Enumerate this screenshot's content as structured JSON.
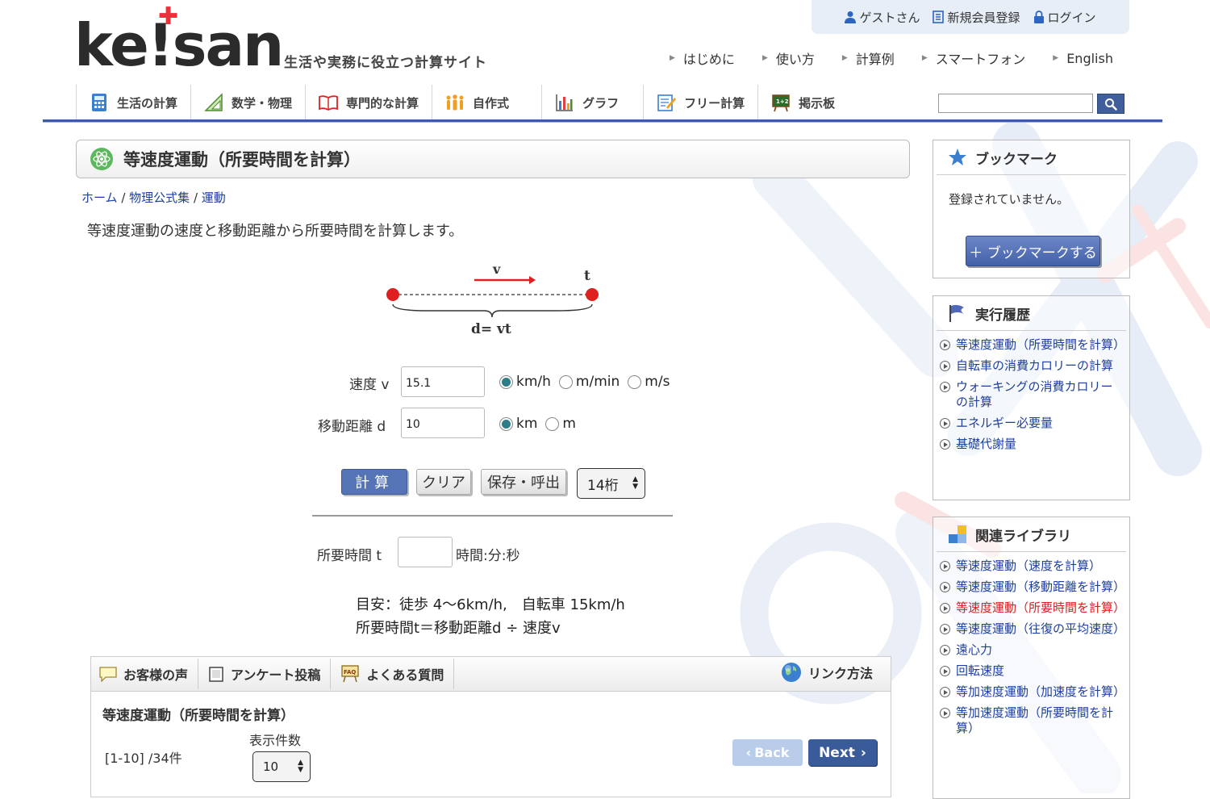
{
  "header": {
    "logo_text": "ke!san",
    "tagline": "生活や実務に役立つ計算サイト",
    "user_bar": {
      "guest": "ゲストさん",
      "register": "新規会員登録",
      "login": "ログイン"
    },
    "top_nav": [
      "はじめに",
      "使い方",
      "計算例",
      "スマートフォン",
      "English"
    ]
  },
  "main_menu": [
    {
      "label": "生活の計算",
      "icon": "calculator-icon"
    },
    {
      "label": "数学・物理",
      "icon": "triangle-ruler-icon"
    },
    {
      "label": "専門的な計算",
      "icon": "book-icon"
    },
    {
      "label": "自作式",
      "icon": "people-icon"
    },
    {
      "label": "グラフ",
      "icon": "bar-chart-icon"
    },
    {
      "label": "フリー計算",
      "icon": "memo-pencil-icon"
    },
    {
      "label": "掲示板",
      "icon": "blackboard-icon"
    }
  ],
  "search": {
    "placeholder": ""
  },
  "page": {
    "title": "等速度運動（所要時間を計算）",
    "breadcrumb": [
      "ホーム",
      "物理公式集",
      "運動"
    ],
    "description": "等速度運動の速度と移動距離から所要時間を計算します。"
  },
  "diagram": {
    "v_label": "v",
    "t_label": "t",
    "formula": "d= vt"
  },
  "form": {
    "speed_label": "速度 v",
    "speed_value": "15.1",
    "speed_units": [
      {
        "label": "km/h",
        "selected": true
      },
      {
        "label": "m/min",
        "selected": false
      },
      {
        "label": "m/s",
        "selected": false
      }
    ],
    "distance_label": "移動距離 d",
    "distance_value": "10",
    "distance_units": [
      {
        "label": "km",
        "selected": true
      },
      {
        "label": "m",
        "selected": false
      }
    ],
    "calc_button": "計算",
    "clear_button": "クリア",
    "save_button": "保存・呼出",
    "digits": "14桁",
    "result_label": "所要時間 t",
    "result_value": "",
    "result_unit": "時間:分:秒"
  },
  "notes": [
    "目安：徒歩 4〜6km/h,　自転車 15km/h",
    "所要時間t＝移動距離d ÷ 速度v"
  ],
  "bottom": {
    "tabs": [
      "お客様の声",
      "アンケート投稿",
      "よくある質問"
    ],
    "link_method": "リンク方法",
    "title": "等速度運動（所要時間を計算）",
    "range": "[1-10] /34件",
    "per_page_label": "表示件数",
    "per_page": "10",
    "back": "Back",
    "next": "Next"
  },
  "sidebar": {
    "bookmark": {
      "title": "ブックマーク",
      "empty": "登録されていません。",
      "button": "＋ ブックマークする"
    },
    "history": {
      "title": "実行履歴",
      "items": [
        "等速度運動（所要時間を計算）",
        "自転車の消費カロリーの計算",
        "ウォーキングの消費カロリーの計算",
        "エネルギー必要量",
        "基礎代謝量"
      ]
    },
    "related": {
      "title": "関連ライブラリ",
      "items": [
        "等速度運動（速度を計算）",
        "等速度運動（移動距離を計算）",
        "等速度運動（所要時間を計算）",
        "等速度運動（往復の平均速度）",
        "遠心力",
        "回転速度",
        "等加速度運動（加速度を計算）",
        "等加速度運動（所要時間を計算）"
      ],
      "current_index": 2
    }
  },
  "colors": {
    "accent": "#3c5aa8",
    "logo_red": "#e8323c",
    "link": "#1d3f9e",
    "current": "#d82020"
  }
}
